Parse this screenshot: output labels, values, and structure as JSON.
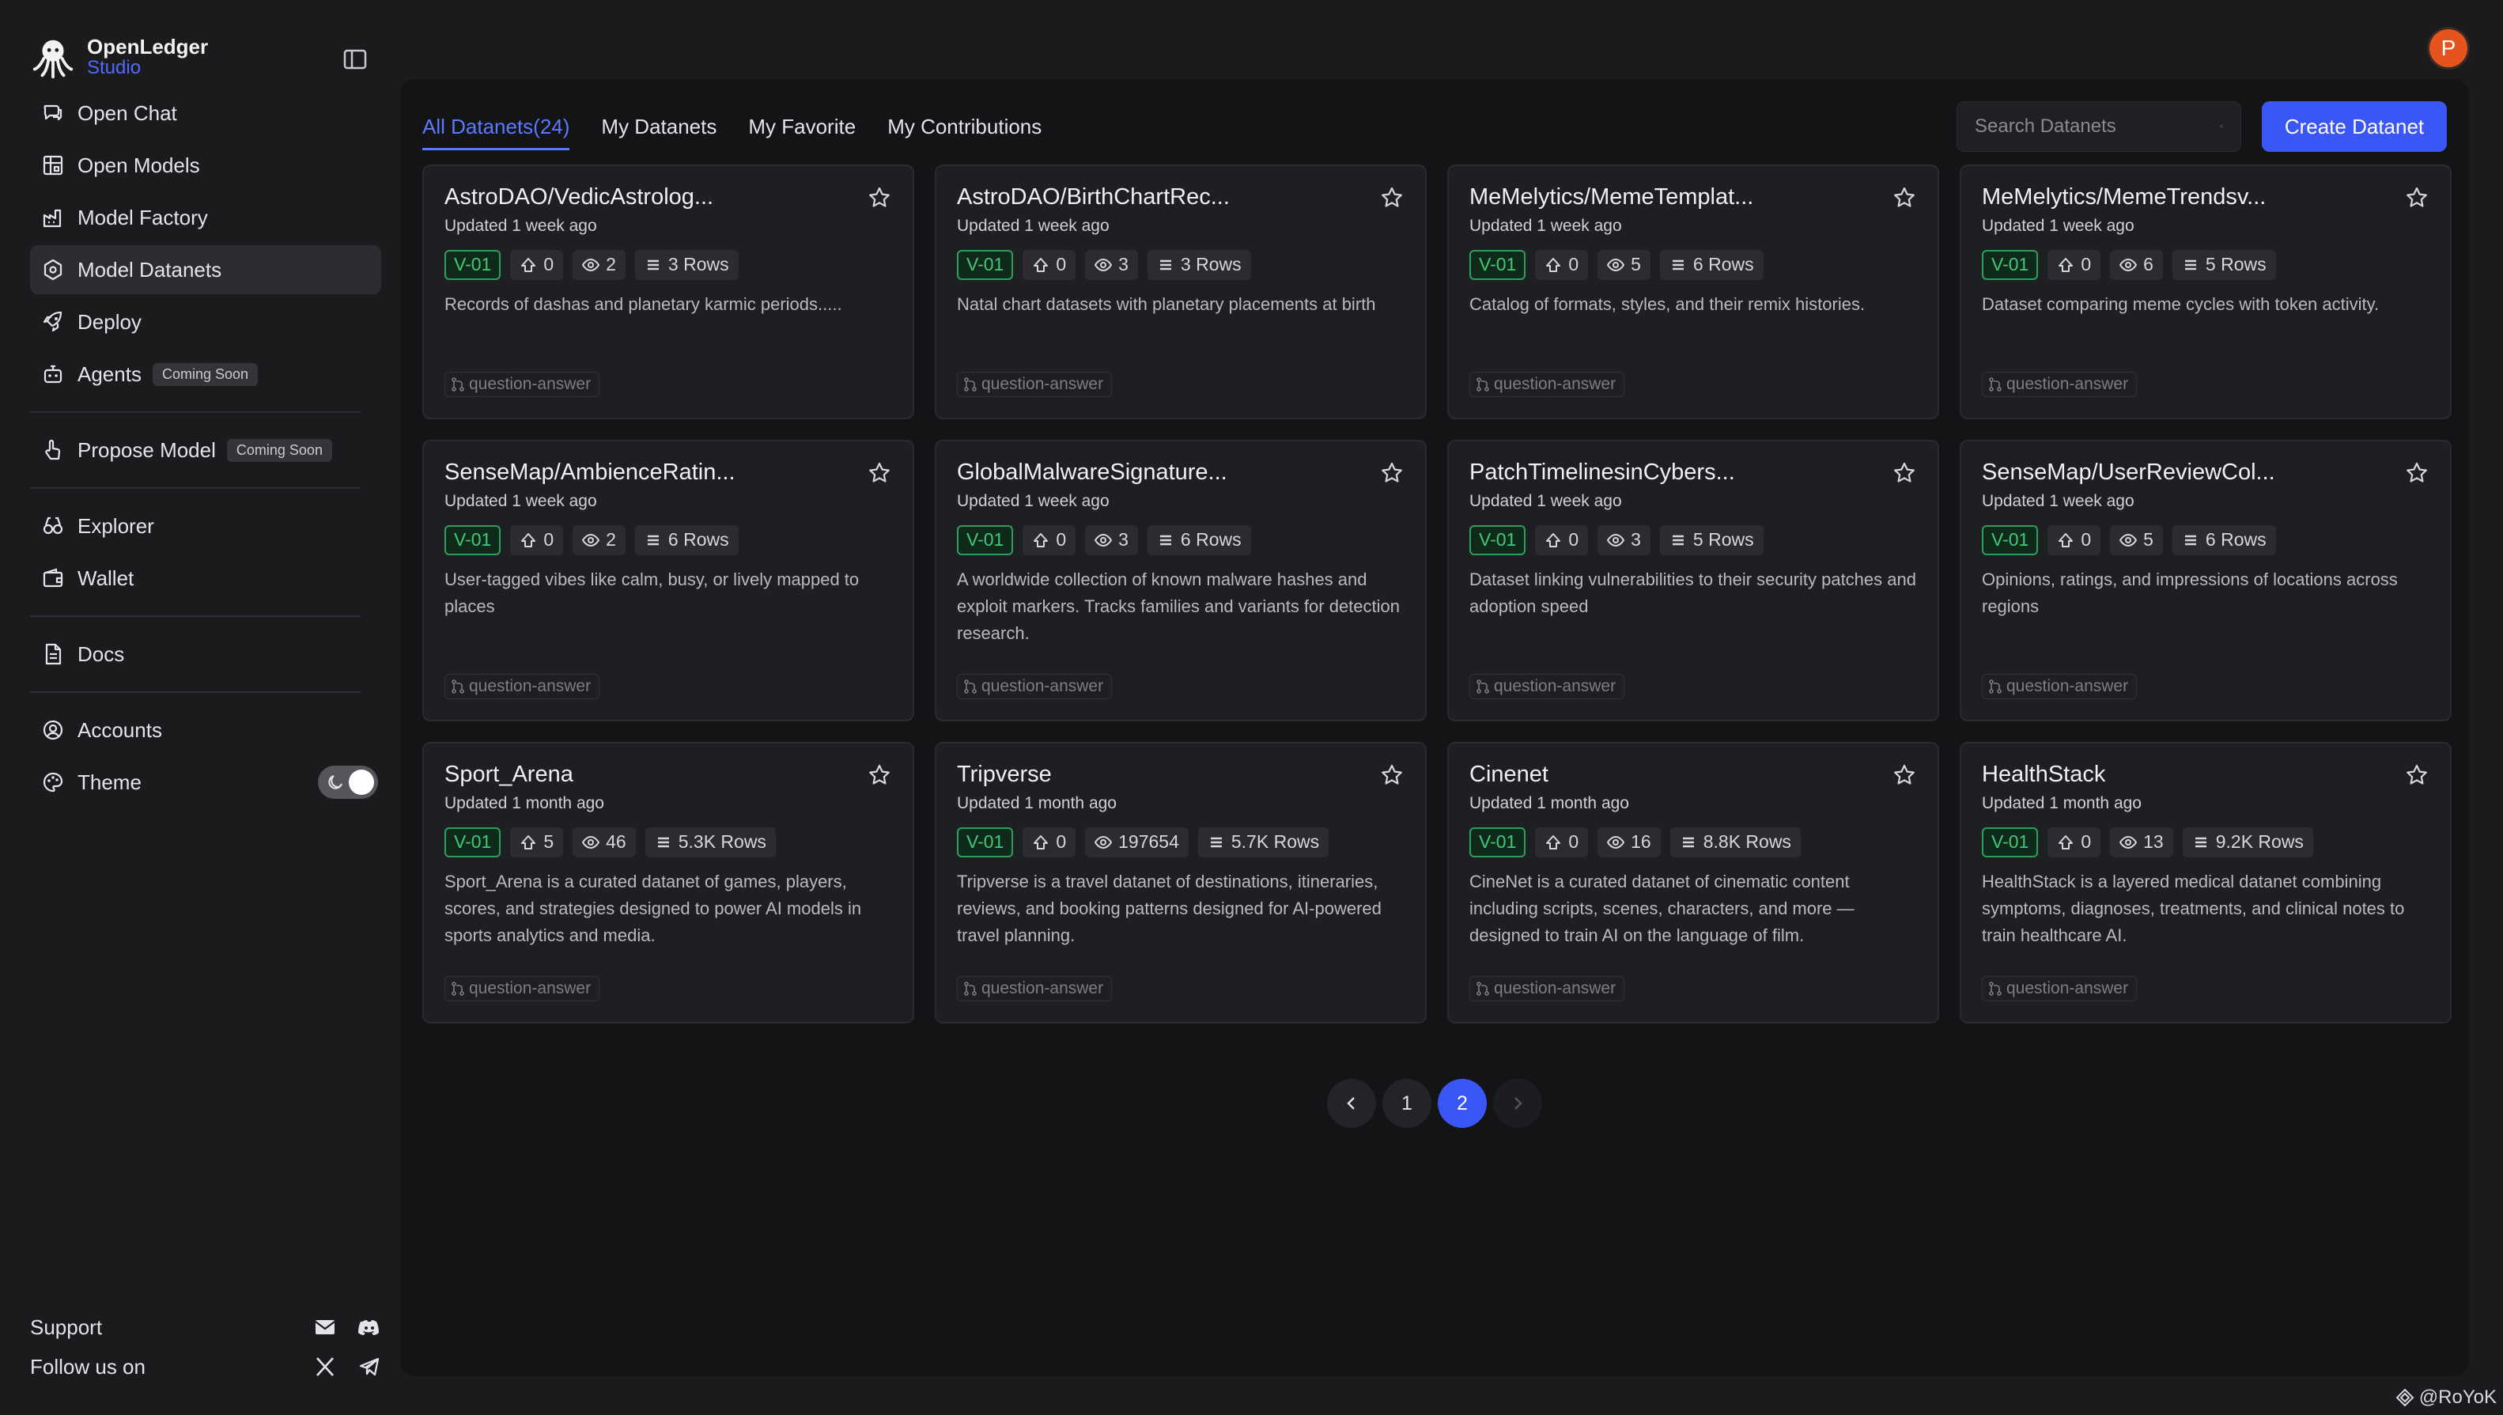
{
  "brand": {
    "name": "OpenLedger",
    "sub": "Studio"
  },
  "sidebar": {
    "items": [
      {
        "label": "Open Chat",
        "icon": "chat-icon"
      },
      {
        "label": "Open Models",
        "icon": "models-icon"
      },
      {
        "label": "Model Factory",
        "icon": "factory-icon"
      },
      {
        "label": "Model Datanets",
        "icon": "datanets-icon",
        "active": true
      },
      {
        "label": "Deploy",
        "icon": "rocket-icon"
      },
      {
        "label": "Agents",
        "icon": "bot-icon",
        "badge": "Coming Soon"
      },
      {
        "label": "Propose Model",
        "icon": "propose-icon",
        "badge": "Coming Soon"
      },
      {
        "label": "Explorer",
        "icon": "explorer-icon"
      },
      {
        "label": "Wallet",
        "icon": "wallet-icon"
      },
      {
        "label": "Docs",
        "icon": "docs-icon"
      },
      {
        "label": "Accounts",
        "icon": "accounts-icon"
      },
      {
        "label": "Theme",
        "icon": "palette-icon"
      }
    ],
    "support": "Support",
    "follow": "Follow us on"
  },
  "avatar": "P",
  "tabs": [
    "All Datanets(24)",
    "My Datanets",
    "My Favorite",
    "My Contributions"
  ],
  "search": {
    "placeholder": "Search Datanets"
  },
  "create_button": "Create Datanet",
  "cards": [
    {
      "title": "AstroDAO/VedicAstrolog...",
      "updated": "Updated 1 week ago",
      "version": "V-01",
      "votes": "0",
      "views": "2",
      "rows": "3 Rows",
      "desc": "Records of dashas and planetary karmic periods.....",
      "tag": "question-answer"
    },
    {
      "title": "AstroDAO/BirthChartRec...",
      "updated": "Updated 1 week ago",
      "version": "V-01",
      "votes": "0",
      "views": "3",
      "rows": "3 Rows",
      "desc": "Natal chart datasets with planetary placements at birth",
      "tag": "question-answer"
    },
    {
      "title": "MeMelytics/MemeTemplat...",
      "updated": "Updated 1 week ago",
      "version": "V-01",
      "votes": "0",
      "views": "5",
      "rows": "6 Rows",
      "desc": "Catalog of formats, styles, and their remix histories.",
      "tag": "question-answer"
    },
    {
      "title": "MeMelytics/MemeTrendsv...",
      "updated": "Updated 1 week ago",
      "version": "V-01",
      "votes": "0",
      "views": "6",
      "rows": "5 Rows",
      "desc": "Dataset comparing meme cycles with token activity.",
      "tag": "question-answer"
    },
    {
      "title": "SenseMap/AmbienceRatin...",
      "updated": "Updated 1 week ago",
      "version": "V-01",
      "votes": "0",
      "views": "2",
      "rows": "6 Rows",
      "desc": "User-tagged vibes like calm, busy, or lively mapped to places",
      "tag": "question-answer"
    },
    {
      "title": "GlobalMalwareSignature...",
      "updated": "Updated 1 week ago",
      "version": "V-01",
      "votes": "0",
      "views": "3",
      "rows": "6 Rows",
      "desc": "A worldwide collection of known malware hashes and exploit markers. Tracks families and variants for detection research.",
      "tag": "question-answer"
    },
    {
      "title": "PatchTimelinesinCybers...",
      "updated": "Updated 1 week ago",
      "version": "V-01",
      "votes": "0",
      "views": "3",
      "rows": "5 Rows",
      "desc": "Dataset linking vulnerabilities to their security patches and adoption speed",
      "tag": "question-answer"
    },
    {
      "title": "SenseMap/UserReviewCol...",
      "updated": "Updated 1 week ago",
      "version": "V-01",
      "votes": "0",
      "views": "5",
      "rows": "6 Rows",
      "desc": "Opinions, ratings, and impressions of locations across regions",
      "tag": "question-answer"
    },
    {
      "title": "Sport_Arena",
      "updated": "Updated 1 month ago",
      "version": "V-01",
      "votes": "5",
      "views": "46",
      "rows": "5.3K Rows",
      "desc": "Sport_Arena is a curated datanet of games, players, scores, and strategies designed to power AI models in sports analytics and media.",
      "tag": "question-answer"
    },
    {
      "title": "Tripverse",
      "updated": "Updated 1 month ago",
      "version": "V-01",
      "votes": "0",
      "views": "197654",
      "rows": "5.7K Rows",
      "desc": "Tripverse is a travel datanet of destinations, itineraries, reviews, and booking patterns designed for AI-powered travel planning.",
      "tag": "question-answer"
    },
    {
      "title": "Cinenet",
      "updated": "Updated 1 month ago",
      "version": "V-01",
      "votes": "0",
      "views": "16",
      "rows": "8.8K Rows",
      "desc": "CineNet is a curated datanet of cinematic content including scripts, scenes, characters, and more — designed to train AI on the language of film.",
      "tag": "question-answer"
    },
    {
      "title": "HealthStack",
      "updated": "Updated 1 month ago",
      "version": "V-01",
      "votes": "0",
      "views": "13",
      "rows": "9.2K Rows",
      "desc": "HealthStack is a layered medical datanet combining symptoms, diagnoses, treatments, and clinical notes to train healthcare AI.",
      "tag": "question-answer"
    }
  ],
  "pagination": {
    "pages": [
      "1",
      "2"
    ],
    "current": "2"
  },
  "watermark": "@RoYoK",
  "colors": {
    "accent": "#3a57f5",
    "version_green": "#43c776",
    "avatar": "#e5531f"
  }
}
